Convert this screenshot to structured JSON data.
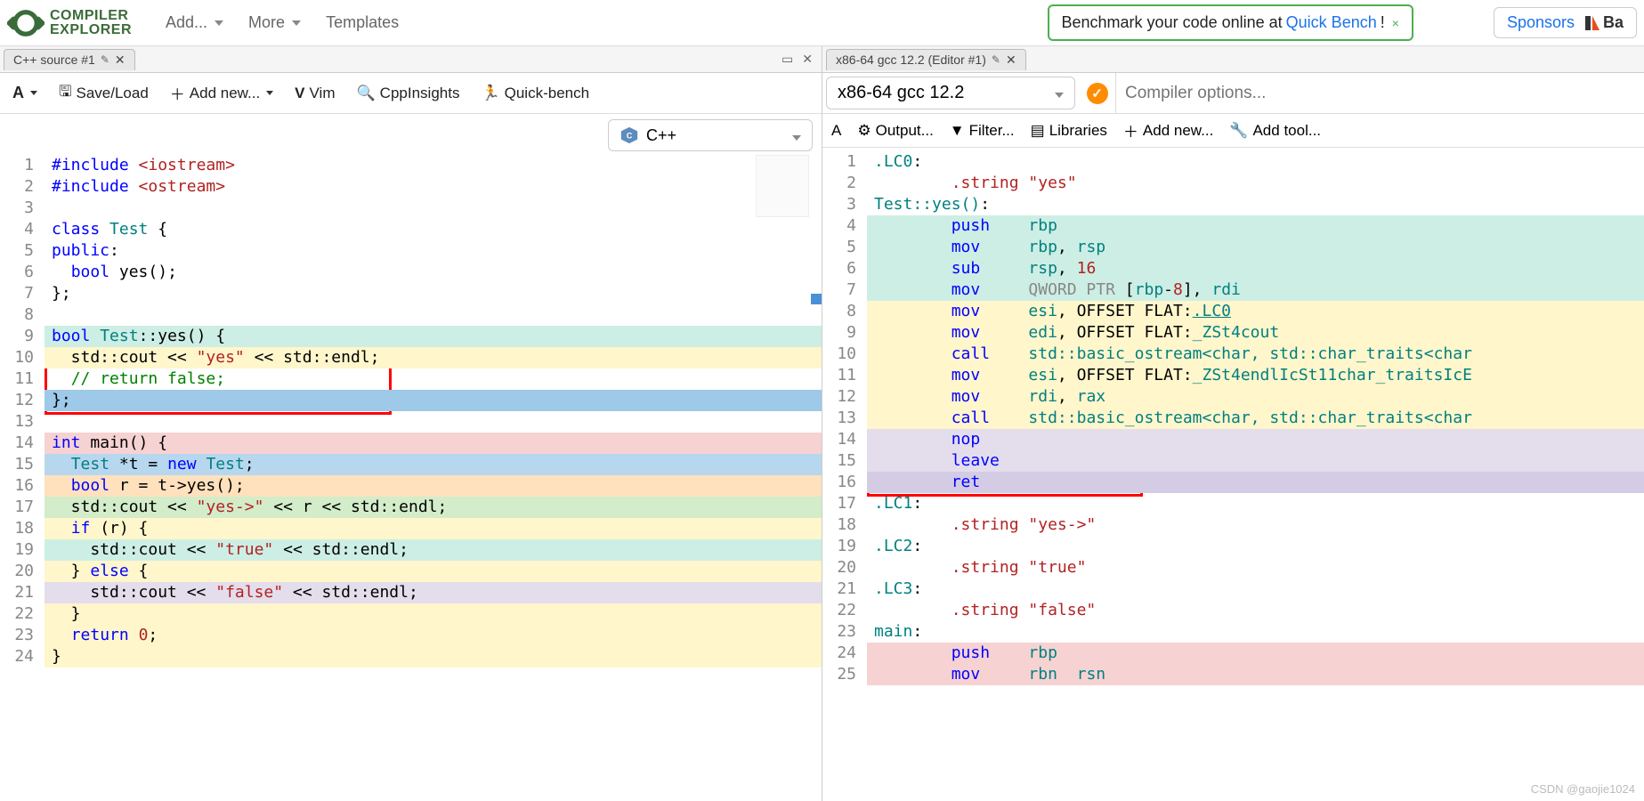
{
  "brand": {
    "line1": "COMPILER",
    "line2": "EXPLORER"
  },
  "topmenu": {
    "add": "Add...",
    "more": "More",
    "templates": "Templates"
  },
  "promo": {
    "prefix": "Benchmark your code online at ",
    "link": "Quick Bench",
    "suffix": "!"
  },
  "sponsors": {
    "label": "Sponsors",
    "brand": "Ba"
  },
  "source_tab": {
    "title": "C++ source #1"
  },
  "source_toolbar": {
    "font": "A",
    "save": "Save/Load",
    "addnew": "Add new...",
    "vim": "Vim",
    "cpp": "CppInsights",
    "qb": "Quick-bench"
  },
  "lang_picker": "C++",
  "source_lines": [
    {
      "n": "1",
      "bg": "",
      "html": "<span class='kw'>#include</span> <span class='str'>&lt;iostream&gt;</span>"
    },
    {
      "n": "2",
      "bg": "",
      "html": "<span class='kw'>#include</span> <span class='str'>&lt;ostream&gt;</span>"
    },
    {
      "n": "3",
      "bg": "",
      "html": ""
    },
    {
      "n": "4",
      "bg": "",
      "html": "<span class='kw'>class</span> <span class='type'>Test</span> {"
    },
    {
      "n": "5",
      "bg": "",
      "html": "<span class='kw'>public</span>:"
    },
    {
      "n": "6",
      "bg": "",
      "html": "  <span class='kw'>bool</span> yes();"
    },
    {
      "n": "7",
      "bg": "",
      "html": "};"
    },
    {
      "n": "8",
      "bg": "",
      "html": ""
    },
    {
      "n": "9",
      "bg": "hl-teal",
      "html": "<span class='kw'>bool</span> <span class='type'>Test</span>::yes() {"
    },
    {
      "n": "10",
      "bg": "hl-yellow",
      "html": "  std::cout &lt;&lt; <span class='str'>\"yes\"</span> &lt;&lt; std::endl;"
    },
    {
      "n": "11",
      "bg": "",
      "html": "  <span class='cmt'>// return false;</span>"
    },
    {
      "n": "12",
      "bg": "hl-blue-dk",
      "html": "};"
    },
    {
      "n": "13",
      "bg": "",
      "html": ""
    },
    {
      "n": "14",
      "bg": "hl-pink",
      "html": "<span class='kw'>int</span> main() {"
    },
    {
      "n": "15",
      "bg": "hl-blue",
      "html": "  <span class='type'>Test</span> *t = <span class='kw'>new</span> <span class='type'>Test</span>;"
    },
    {
      "n": "16",
      "bg": "hl-orange",
      "html": "  <span class='kw'>bool</span> r = t-&gt;yes();"
    },
    {
      "n": "17",
      "bg": "hl-green",
      "html": "  std::cout &lt;&lt; <span class='str'>\"yes-&gt;\"</span> &lt;&lt; r &lt;&lt; std::endl;"
    },
    {
      "n": "18",
      "bg": "hl-yellow",
      "html": "  <span class='kw'>if</span> (r) {"
    },
    {
      "n": "19",
      "bg": "hl-teal",
      "html": "    std::cout &lt;&lt; <span class='str'>\"true\"</span> &lt;&lt; std::endl;"
    },
    {
      "n": "20",
      "bg": "hl-yellow",
      "html": "  } <span class='kw'>else</span> {"
    },
    {
      "n": "21",
      "bg": "hl-lav",
      "html": "    std::cout &lt;&lt; <span class='str'>\"false\"</span> &lt;&lt; std::endl;"
    },
    {
      "n": "22",
      "bg": "hl-yellow",
      "html": "  }"
    },
    {
      "n": "23",
      "bg": "hl-yellow",
      "html": "  <span class='kw'>return</span> <span class='num'>0</span>;"
    },
    {
      "n": "24",
      "bg": "hl-yellow",
      "html": "}"
    }
  ],
  "compiler_tab": {
    "title": "x86-64 gcc 12.2 (Editor #1)"
  },
  "compiler_select": "x86-64 gcc 12.2",
  "compiler_opts_placeholder": "Compiler options...",
  "asm_toolbar": {
    "font": "A",
    "output": "Output...",
    "filter": "Filter...",
    "libs": "Libraries",
    "addnew": "Add new...",
    "addtool": "Add tool..."
  },
  "asm_lines": [
    {
      "n": "1",
      "bg": "",
      "html": "<span class='label'>.LC0</span>:"
    },
    {
      "n": "2",
      "bg": "",
      "html": "        <span class='dir'>.string</span> <span class='str'>\"yes\"</span>"
    },
    {
      "n": "3",
      "bg": "",
      "html": "<span class='label'>Test::yes()</span>:"
    },
    {
      "n": "4",
      "bg": "hl-teal",
      "html": "        <span class='inst'>push</span>    <span class='reg'>rbp</span>"
    },
    {
      "n": "5",
      "bg": "hl-teal",
      "html": "        <span class='inst'>mov</span>     <span class='reg'>rbp</span>, <span class='reg'>rsp</span>"
    },
    {
      "n": "6",
      "bg": "hl-teal",
      "html": "        <span class='inst'>sub</span>     <span class='reg'>rsp</span>, <span class='num'>16</span>"
    },
    {
      "n": "7",
      "bg": "hl-teal",
      "html": "        <span class='inst'>mov</span>     <span class='gray'>QWORD PTR</span> [<span class='reg'>rbp</span>-<span class='num'>8</span>], <span class='reg'>rdi</span>"
    },
    {
      "n": "8",
      "bg": "hl-yellow",
      "html": "        <span class='inst'>mov</span>     <span class='reg'>esi</span>, OFFSET FLAT:<span class='label lnk'>.LC0</span>"
    },
    {
      "n": "9",
      "bg": "hl-yellow",
      "html": "        <span class='inst'>mov</span>     <span class='reg'>edi</span>, OFFSET FLAT:<span class='label'>_ZSt4cout</span>"
    },
    {
      "n": "10",
      "bg": "hl-yellow",
      "html": "        <span class='inst'>call</span>    <span class='label'>std::basic_ostream&lt;char, std::char_traits&lt;char</span>"
    },
    {
      "n": "11",
      "bg": "hl-yellow",
      "html": "        <span class='inst'>mov</span>     <span class='reg'>esi</span>, OFFSET FLAT:<span class='label'>_ZSt4endlIcSt11char_traitsIcE</span>"
    },
    {
      "n": "12",
      "bg": "hl-yellow",
      "html": "        <span class='inst'>mov</span>     <span class='reg'>rdi</span>, <span class='reg'>rax</span>"
    },
    {
      "n": "13",
      "bg": "hl-yellow",
      "html": "        <span class='inst'>call</span>    <span class='label'>std::basic_ostream&lt;char, std::char_traits&lt;char</span>"
    },
    {
      "n": "14",
      "bg": "hl-lav",
      "html": "        <span class='inst'>nop</span>"
    },
    {
      "n": "15",
      "bg": "hl-lav",
      "html": "        <span class='inst'>leave</span>"
    },
    {
      "n": "16",
      "bg": "hl-lav-sel",
      "html": "        <span class='inst'>ret</span>"
    },
    {
      "n": "17",
      "bg": "",
      "html": "<span class='label'>.LC1</span>:"
    },
    {
      "n": "18",
      "bg": "",
      "html": "        <span class='dir'>.string</span> <span class='str'>\"yes-&gt;\"</span>"
    },
    {
      "n": "19",
      "bg": "",
      "html": "<span class='label'>.LC2</span>:"
    },
    {
      "n": "20",
      "bg": "",
      "html": "        <span class='dir'>.string</span> <span class='str'>\"true\"</span>"
    },
    {
      "n": "21",
      "bg": "",
      "html": "<span class='label'>.LC3</span>:"
    },
    {
      "n": "22",
      "bg": "",
      "html": "        <span class='dir'>.string</span> <span class='str'>\"false\"</span>"
    },
    {
      "n": "23",
      "bg": "",
      "html": "<span class='label'>main</span>:"
    },
    {
      "n": "24",
      "bg": "hl-pink",
      "html": "        <span class='inst'>push</span>    <span class='reg'>rbp</span>"
    },
    {
      "n": "25",
      "bg": "hl-pink",
      "html": "        <span class='inst'>mov</span>     <span class='reg'>rbn</span>  <span class='reg'>rsn</span>"
    }
  ],
  "watermark": "CSDN @gaojie1024"
}
